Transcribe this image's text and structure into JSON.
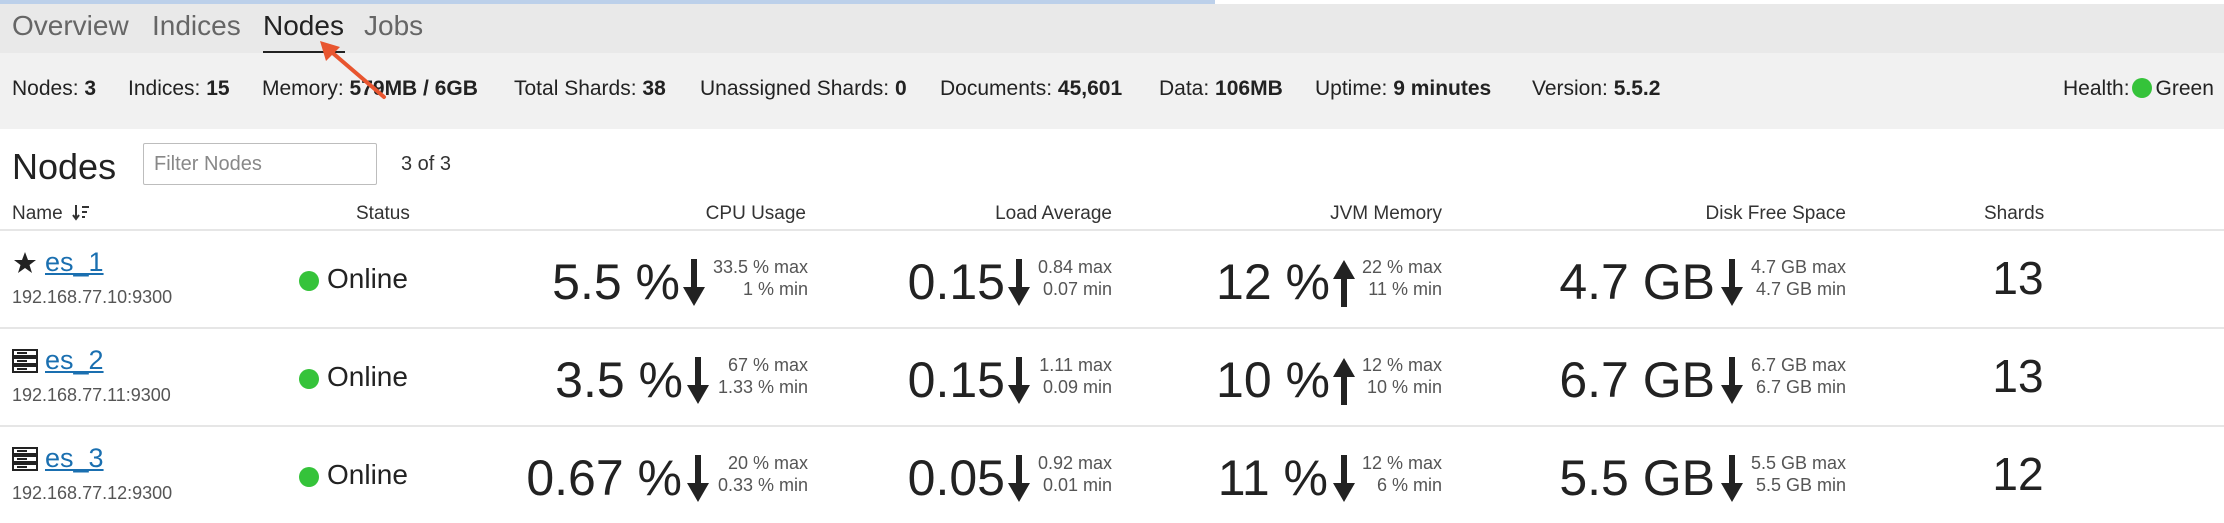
{
  "tabs": [
    {
      "label": "Overview",
      "active": false
    },
    {
      "label": "Indices",
      "active": false
    },
    {
      "label": "Nodes",
      "active": true
    },
    {
      "label": "Jobs",
      "active": false
    }
  ],
  "stats": {
    "nodes": {
      "label": "Nodes:",
      "value": "3"
    },
    "indices": {
      "label": "Indices:",
      "value": "15"
    },
    "memory": {
      "label": "Memory:",
      "value": "579MB / 6GB"
    },
    "total_shards": {
      "label": "Total Shards:",
      "value": "38"
    },
    "unassigned_shards": {
      "label": "Unassigned Shards:",
      "value": "0"
    },
    "documents": {
      "label": "Documents:",
      "value": "45,601"
    },
    "data": {
      "label": "Data:",
      "value": "106MB"
    },
    "uptime": {
      "label": "Uptime:",
      "value": "9 minutes"
    },
    "version": {
      "label": "Version:",
      "value": "5.5.2"
    },
    "health": {
      "label": "Health:",
      "value": "Green",
      "color": "#35c33a"
    }
  },
  "section": {
    "title": "Nodes",
    "filter_placeholder": "Filter Nodes",
    "count": "3 of 3"
  },
  "columns": {
    "name": "Name",
    "status": "Status",
    "cpu": "CPU Usage",
    "load": "Load Average",
    "jvm": "JVM Memory",
    "disk": "Disk Free Space",
    "shards": "Shards"
  },
  "nodes": [
    {
      "icon": "star-icon",
      "name": "es_1",
      "ip": "192.168.77.10:9300",
      "status": "Online",
      "cpu": {
        "value": "5.5 %",
        "trend": "down",
        "max": "33.5 % max",
        "min": "1 % min"
      },
      "load": {
        "value": "0.15",
        "trend": "down",
        "max": "0.84 max",
        "min": "0.07 min"
      },
      "jvm": {
        "value": "12 %",
        "trend": "up",
        "max": "22 % max",
        "min": "11 % min"
      },
      "disk": {
        "value": "4.7 GB",
        "trend": "down",
        "max": "4.7 GB max",
        "min": "4.7 GB min"
      },
      "shards": "13"
    },
    {
      "icon": "server-icon",
      "name": "es_2",
      "ip": "192.168.77.11:9300",
      "status": "Online",
      "cpu": {
        "value": "3.5 %",
        "trend": "down",
        "max": "67 % max",
        "min": "1.33 % min"
      },
      "load": {
        "value": "0.15",
        "trend": "down",
        "max": "1.11 max",
        "min": "0.09 min"
      },
      "jvm": {
        "value": "10 %",
        "trend": "up",
        "max": "12 % max",
        "min": "10 % min"
      },
      "disk": {
        "value": "6.7 GB",
        "trend": "down",
        "max": "6.7 GB max",
        "min": "6.7 GB min"
      },
      "shards": "13"
    },
    {
      "icon": "server-icon",
      "name": "es_3",
      "ip": "192.168.77.12:9300",
      "status": "Online",
      "cpu": {
        "value": "0.67 %",
        "trend": "down",
        "max": "20 % max",
        "min": "0.33 % min"
      },
      "load": {
        "value": "0.05",
        "trend": "down",
        "max": "0.92 max",
        "min": "0.01 min"
      },
      "jvm": {
        "value": "11 %",
        "trend": "down",
        "max": "12 % max",
        "min": "6 % min"
      },
      "disk": {
        "value": "5.5 GB",
        "trend": "down",
        "max": "5.5 GB max",
        "min": "5.5 GB min"
      },
      "shards": "12"
    }
  ]
}
